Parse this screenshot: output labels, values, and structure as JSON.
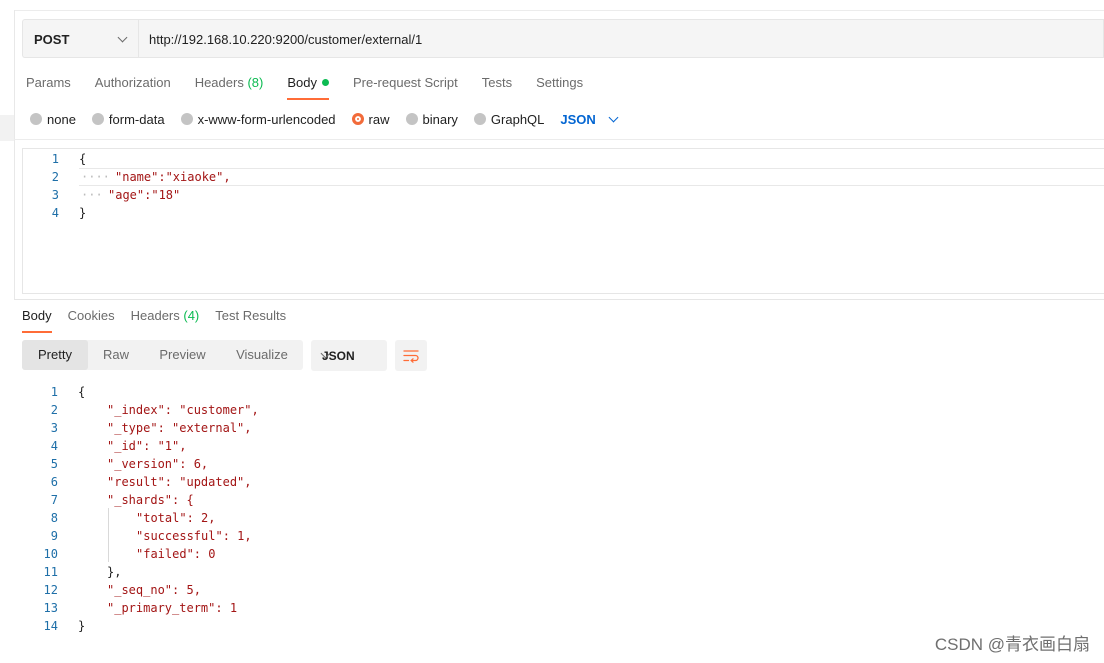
{
  "request": {
    "method": "POST",
    "url": "http://192.168.10.220:9200/customer/external/1"
  },
  "request_tabs": [
    {
      "label": "Params"
    },
    {
      "label": "Authorization"
    },
    {
      "label": "Headers",
      "count": "(8)"
    },
    {
      "label": "Body",
      "active": true
    },
    {
      "label": "Pre-request Script"
    },
    {
      "label": "Tests"
    },
    {
      "label": "Settings"
    }
  ],
  "body_types": [
    "none",
    "form-data",
    "x-www-form-urlencoded",
    "raw",
    "binary",
    "GraphQL"
  ],
  "body_type_selected": "raw",
  "body_format": "JSON",
  "request_body": {
    "line_numbers": [
      "1",
      "2",
      "3",
      "4"
    ],
    "lines": [
      "{",
      "\"name\":\"xiaoke\",",
      "\"age\":\"18\"",
      "}"
    ]
  },
  "response_tabs": [
    {
      "label": "Body",
      "active": true
    },
    {
      "label": "Cookies"
    },
    {
      "label": "Headers",
      "count": "(4)"
    },
    {
      "label": "Test Results"
    }
  ],
  "view_modes": [
    "Pretty",
    "Raw",
    "Preview",
    "Visualize"
  ],
  "view_mode_selected": "Pretty",
  "response_format": "JSON",
  "response_body": {
    "line_numbers": [
      "1",
      "2",
      "3",
      "4",
      "5",
      "6",
      "7",
      "8",
      "9",
      "10",
      "11",
      "12",
      "13",
      "14"
    ],
    "lines": [
      "{",
      "\"_index\": \"customer\",",
      "\"_type\": \"external\",",
      "\"_id\": \"1\",",
      "\"_version\": 6,",
      "\"result\": \"updated\",",
      "\"_shards\": {",
      "\"total\": 2,",
      "\"successful\": 1,",
      "\"failed\": 0",
      "},",
      "\"_seq_no\": 5,",
      "\"_primary_term\": 1",
      "}"
    ]
  },
  "watermark": "CSDN @青衣画白扇",
  "colors": {
    "accent": "#ff6c37",
    "green": "#0cbb52",
    "blue": "#0265d2"
  },
  "icons": [
    "chevron-down-icon",
    "wrap-lines-icon"
  ]
}
